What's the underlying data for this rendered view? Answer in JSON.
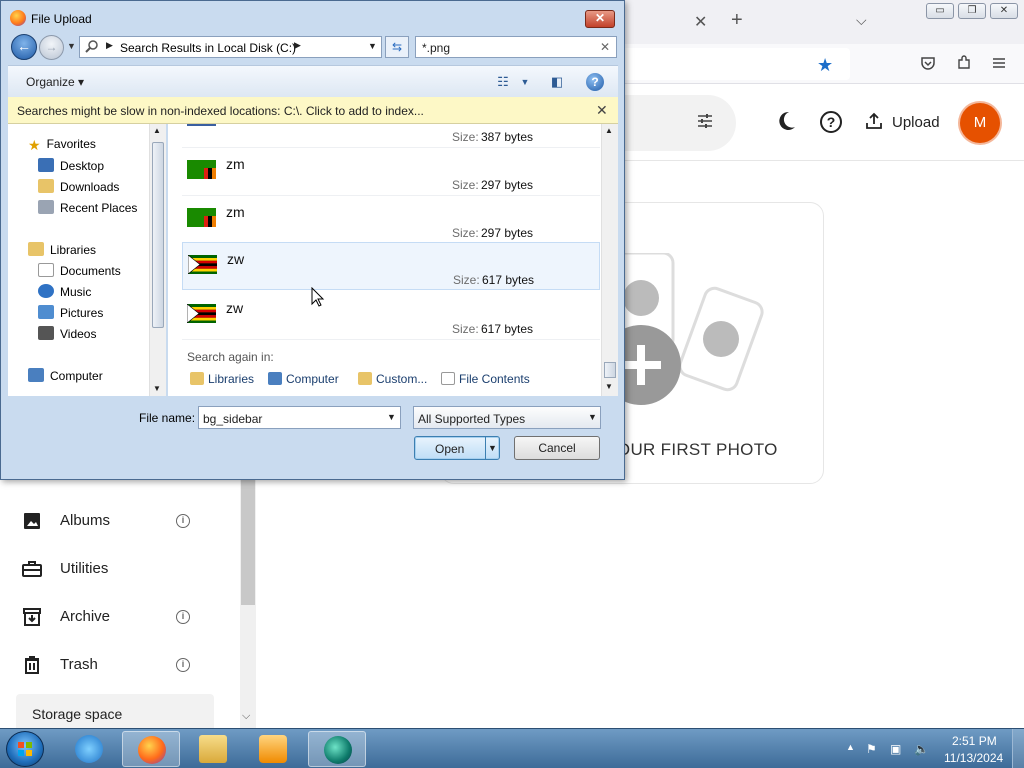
{
  "browser": {
    "tab_close": "✕",
    "tab_new": "+",
    "tab_list": "⌵",
    "window_controls": {
      "minimize": "▭",
      "restore": "❐",
      "close": "✕"
    }
  },
  "app": {
    "header": {
      "upload_label": "Upload",
      "avatar_initial": "M"
    },
    "empty_state": {
      "text": "D YOUR FIRST PHOTO"
    },
    "sidebar": {
      "items": [
        {
          "label": "Albums",
          "info": "i"
        },
        {
          "label": "Utilities"
        },
        {
          "label": "Archive",
          "info": "i"
        },
        {
          "label": "Trash",
          "info": "i"
        }
      ],
      "storage_label": "Storage space"
    }
  },
  "dialog": {
    "title": "File Upload",
    "address": "Search Results in Local Disk (C:)",
    "search_value": "*.png",
    "organize_label": "Organize",
    "infobar_text": "Searches might be slow in non-indexed locations: C:\\. Click to add to index...",
    "nav": {
      "favorites": "Favorites",
      "favorites_items": [
        "Desktop",
        "Downloads",
        "Recent Places"
      ],
      "libraries": "Libraries",
      "libraries_items": [
        "Documents",
        "Music",
        "Pictures",
        "Videos"
      ],
      "computer": "Computer"
    },
    "size_label": "Size:",
    "partial_row_size": "387 bytes",
    "files": [
      {
        "name": "zm",
        "size": "297 bytes",
        "flag": "zambia"
      },
      {
        "name": "zm",
        "size": "297 bytes",
        "flag": "zambia"
      },
      {
        "name": "zw",
        "size": "617 bytes",
        "flag": "zimbabwe",
        "hovered": true
      },
      {
        "name": "zw",
        "size": "617 bytes",
        "flag": "zimbabwe"
      }
    ],
    "search_again": {
      "label": "Search again in:",
      "locations": [
        "Libraries",
        "Computer",
        "Custom...",
        "File Contents"
      ]
    },
    "file_name_label": "File name:",
    "file_name_value": "bg_sidebar",
    "file_type_value": "All Supported Types",
    "open_label": "Open",
    "cancel_label": "Cancel",
    "close_glyph": "✕"
  },
  "taskbar": {
    "time": "2:51 PM",
    "date": "11/13/2024",
    "apps": [
      "internet-explorer",
      "firefox",
      "file-explorer",
      "media-player",
      "app-viewer"
    ]
  },
  "colors": {
    "accent_blue": "#1d6ec9",
    "avatar_orange": "#e65100",
    "infobar_yellow": "#fdf8c6",
    "dialog_frame": "#c9dbef"
  }
}
